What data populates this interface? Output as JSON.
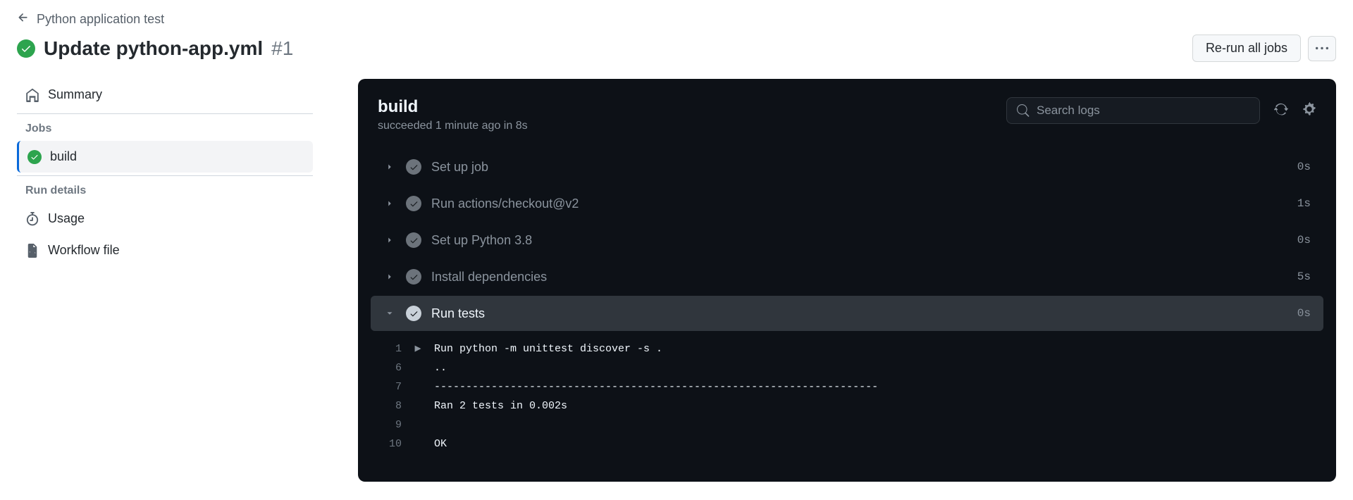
{
  "breadcrumb": {
    "workflow_name": "Python application test"
  },
  "header": {
    "title": "Update python-app.yml",
    "run_number": "#1",
    "rerun_label": "Re-run all jobs"
  },
  "sidebar": {
    "summary_label": "Summary",
    "jobs_label": "Jobs",
    "job_name": "build",
    "run_details_label": "Run details",
    "usage_label": "Usage",
    "workflow_file_label": "Workflow file"
  },
  "log_panel": {
    "title": "build",
    "subtitle": "succeeded 1 minute ago in 8s",
    "search_placeholder": "Search logs"
  },
  "steps": [
    {
      "label": "Set up job",
      "duration": "0s",
      "expanded": false
    },
    {
      "label": "Run actions/checkout@v2",
      "duration": "1s",
      "expanded": false
    },
    {
      "label": "Set up Python 3.8",
      "duration": "0s",
      "expanded": false
    },
    {
      "label": "Install dependencies",
      "duration": "5s",
      "expanded": false
    },
    {
      "label": "Run tests",
      "duration": "0s",
      "expanded": true
    }
  ],
  "log_lines": [
    {
      "n": "1",
      "caret": true,
      "text": "Run python -m unittest discover -s ."
    },
    {
      "n": "6",
      "caret": false,
      "text": ".."
    },
    {
      "n": "7",
      "caret": false,
      "text": "----------------------------------------------------------------------"
    },
    {
      "n": "8",
      "caret": false,
      "text": "Ran 2 tests in 0.002s"
    },
    {
      "n": "9",
      "caret": false,
      "text": ""
    },
    {
      "n": "10",
      "caret": false,
      "text": "OK"
    }
  ]
}
